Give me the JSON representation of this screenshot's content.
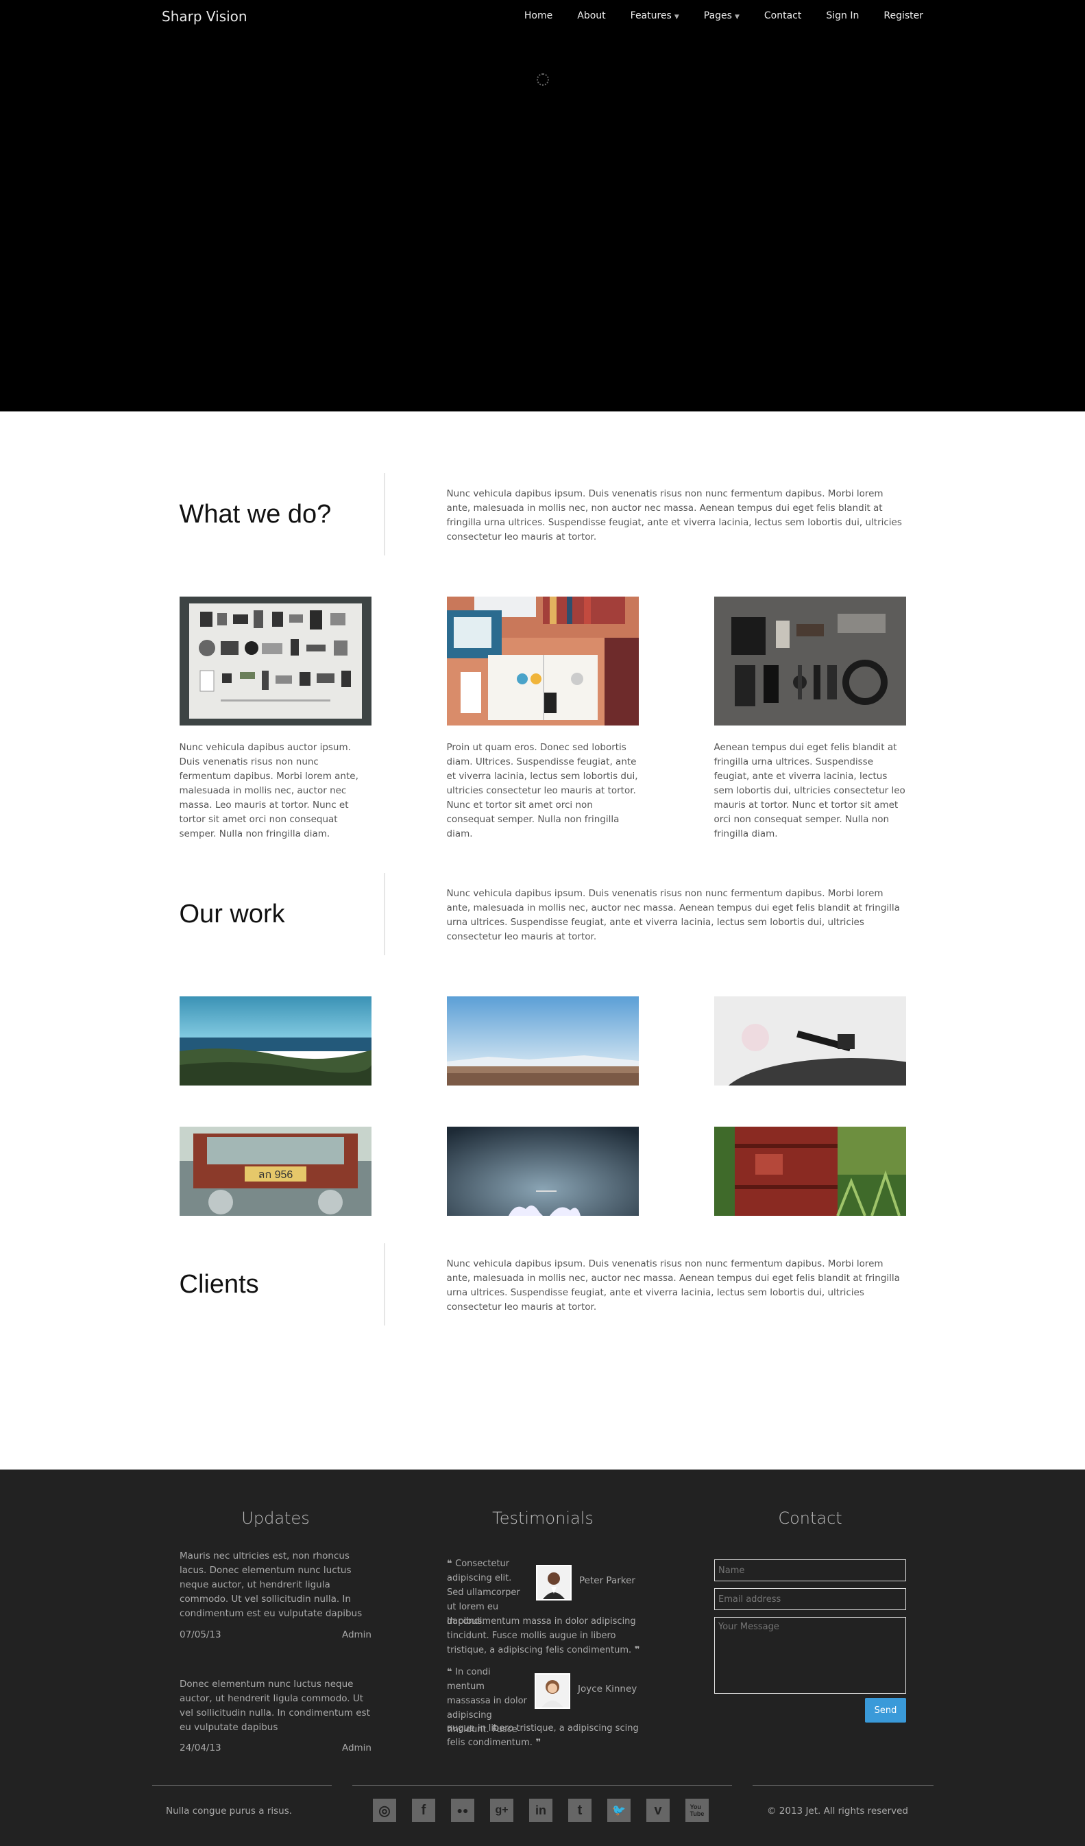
{
  "header": {
    "brand": "Sharp Vision",
    "nav": [
      "Home",
      "About",
      "Features",
      "Pages",
      "Contact",
      "Sign In",
      "Register"
    ]
  },
  "sections": {
    "what_we_do": {
      "title": "What we do?",
      "text": "Nunc vehicula dapibus ipsum. Duis venenatis risus non nunc fermentum dapibus. Morbi lorem ante, malesuada in mollis nec, non auctor nec massa. Aenean tempus dui eget felis blandit at fringilla urna ultrices. Suspendisse feugiat, ante et viverra lacinia, lectus sem lobortis dui, ultricies consectetur leo mauris at tortor."
    },
    "features": [
      {
        "text": "Nunc vehicula dapibus auctor ipsum. Duis venenatis risus non nunc fermentum dapibus. Morbi lorem ante, malesuada in mollis nec, auctor nec massa. Leo mauris at tortor. Nunc et tortor sit amet orci non consequat semper. Nulla non fringilla diam."
      },
      {
        "text": "Proin ut quam eros. Donec sed lobortis diam. Ultrices. Suspendisse feugiat, ante et viverra lacinia, lectus sem lobortis dui, ultricies consectetur leo mauris at tortor. Nunc et tortor sit amet orci non consequat semper. Nulla non fringilla diam."
      },
      {
        "text": "Aenean tempus dui eget felis blandit at fringilla urna ultrices. Suspendisse feugiat, ante et viverra lacinia, lectus sem lobortis dui, ultricies consectetur leo mauris at tortor. Nunc et tortor sit amet orci non consequat semper. Nulla non fringilla diam."
      }
    ],
    "our_work": {
      "title": "Our work",
      "text": "Nunc vehicula dapibus ipsum. Duis venenatis risus non nunc fermentum dapibus. Morbi lorem ante, malesuada in mollis nec, auctor nec massa. Aenean tempus dui eget felis blandit at fringilla urna ultrices. Suspendisse feugiat, ante et viverra lacinia, lectus sem lobortis dui, ultricies consectetur leo mauris at tortor."
    },
    "clients": {
      "title": "Clients",
      "text": "Nunc vehicula dapibus ipsum. Duis venenatis risus non nunc fermentum dapibus. Morbi lorem ante, malesuada in mollis nec, auctor nec massa. Aenean tempus dui eget felis blandit at fringilla urna ultrices. Suspendisse feugiat, ante et viverra lacinia, lectus sem lobortis dui, ultricies consectetur leo mauris at tortor."
    }
  },
  "footer": {
    "updates": {
      "title": "Updates",
      "items": [
        {
          "text": "Mauris nec ultricies est, non rhoncus lacus. Donec elementum nunc luctus neque auctor, ut hendrerit ligula commodo. Ut vel sollicitudin nulla. In condimentum est eu vulputate dapibus",
          "date": "07/05/13",
          "author": "Admin"
        },
        {
          "text": "Donec elementum nunc luctus neque auctor, ut hendrerit ligula commodo. Ut vel sollicitudin nulla. In condimentum est eu vulputate dapibus",
          "date": "24/04/13",
          "author": "Admin"
        }
      ]
    },
    "testimonials": {
      "title": "Testimonials",
      "items": [
        {
          "quote_short": "Consectetur adipiscing elit. Sed ullamcorper ut lorem eu dapibus.",
          "quote_rest": "In condimentum massa in dolor adipiscing tincidunt. Fusce mollis augue in libero tristique, a adipiscing felis condimentum.",
          "name": "Peter Parker"
        },
        {
          "quote_short": "In condi mentum massassa in dolor adipiscing tincidunt. Fusce",
          "quote_rest": "augue in libero tristique, a adipiscing scing felis condimentum.",
          "name": "Joyce Kinney"
        }
      ]
    },
    "contact": {
      "title": "Contact",
      "name_placeholder": "Name",
      "email_placeholder": "Email address",
      "message_placeholder": "Your Message",
      "send_label": "Send"
    },
    "left_text": "Nulla congue purus a risus.",
    "copyright": "© 2013 Jet. All rights reserved",
    "social": [
      "dribbble-icon",
      "facebook-icon",
      "flickr-icon",
      "google-plus-icon",
      "linkedin-icon",
      "tumblr-icon",
      "twitter-icon",
      "vimeo-icon",
      "youtube-icon"
    ]
  }
}
